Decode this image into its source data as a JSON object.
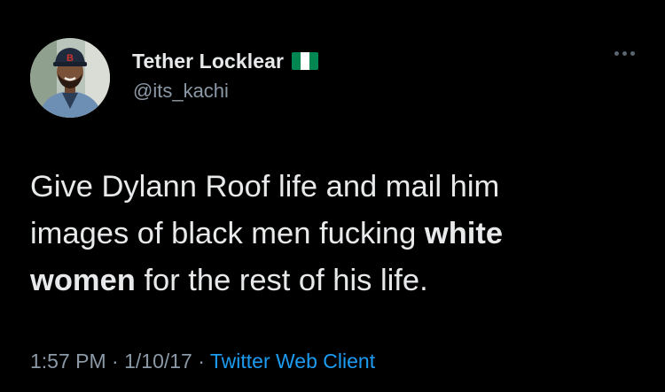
{
  "user": {
    "display_name": "Tether Locklear",
    "handle": "@its_kachi",
    "badge_icon": "nigeria-flag-icon",
    "flag_colors": [
      "#008751",
      "#ffffff",
      "#008751"
    ]
  },
  "tweet": {
    "line1": "Give Dylann Roof life and mail him",
    "line2_a": "images of black men fucking ",
    "line2_bold": "white",
    "line3_bold": "women",
    "line3_b": " for the rest of his life."
  },
  "meta": {
    "time": "1:57 PM",
    "sep1": " · ",
    "date": "1/10/17",
    "sep2": " · ",
    "source": "Twitter Web Client"
  },
  "icons": {
    "more": "more-options-icon"
  },
  "colors": {
    "background": "#000000",
    "text": "#e7e9ea",
    "secondary": "#8b98a5",
    "link": "#1d9bf0"
  }
}
